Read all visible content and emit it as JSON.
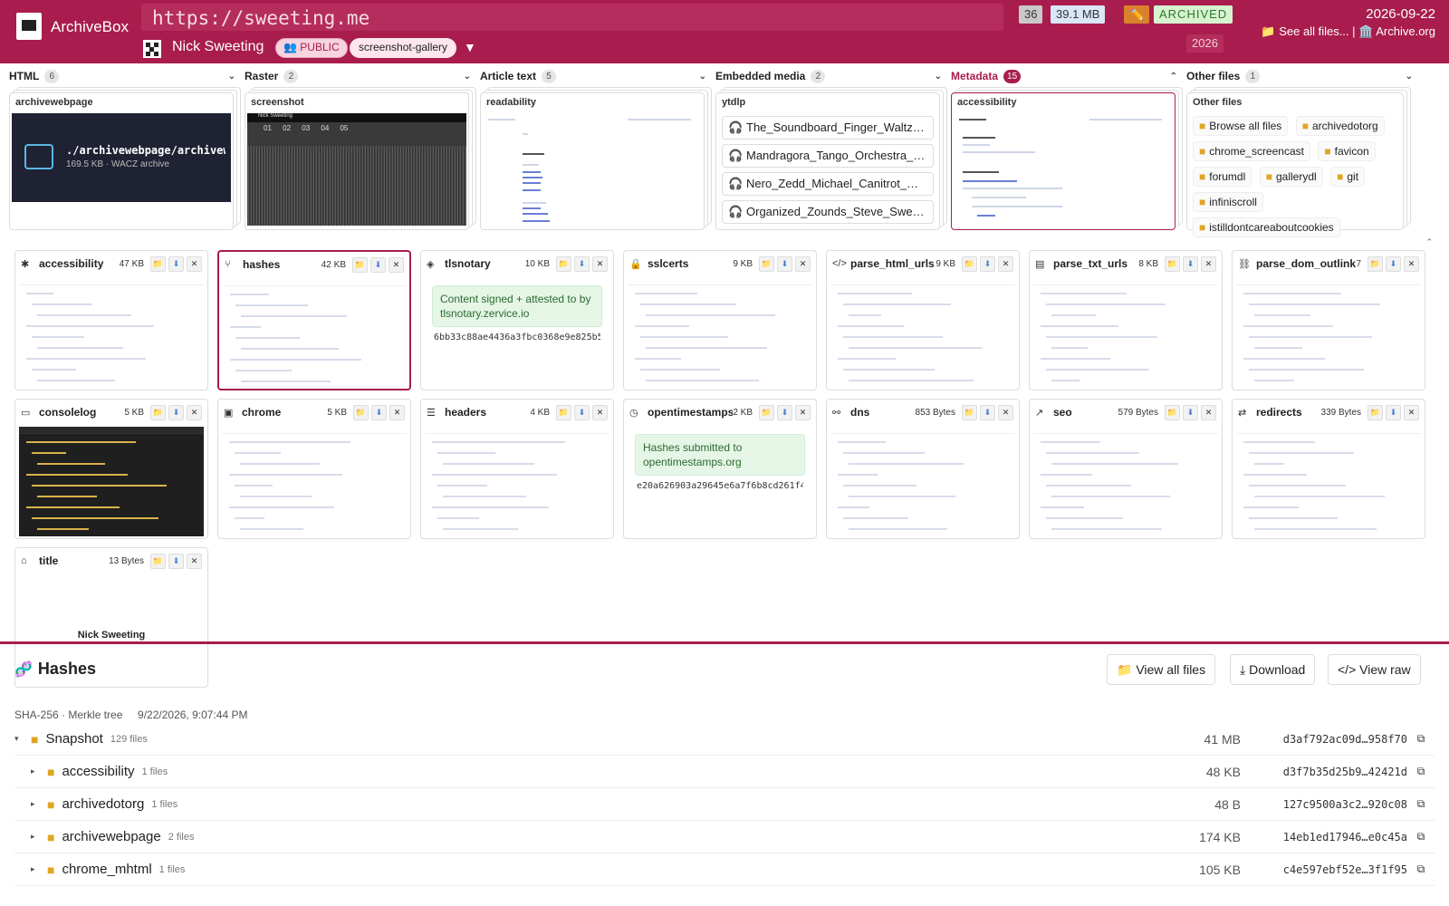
{
  "header": {
    "app_name": "ArchiveBox",
    "url": "https://sweeting.me",
    "owner": "Nick Sweeting",
    "visibility": "👥 PUBLIC",
    "tag": "screenshot-gallery",
    "stat_count": "36",
    "stat_size": "39.1 MB",
    "stat_edit_icon": "✏️",
    "status": "ARCHIVED",
    "year": "2026",
    "date": "2026-09-22",
    "link_files": "📁 See all files...",
    "link_sep": " | ",
    "link_archive": "🏛️ Archive.org",
    "accent_color": "#a91d4e"
  },
  "categories": [
    {
      "label": "HTML",
      "count": "6",
      "card_title": "archivewebpage",
      "file_name": "./archivewebpage/archivew…",
      "file_meta": "169.5 KB · WACZ archive"
    },
    {
      "label": "Raster",
      "count": "2",
      "card_title": "screenshot",
      "nums": "01 02 03 04 05",
      "caption": "Nick Sweeting"
    },
    {
      "label": "Article text",
      "count": "5",
      "card_title": "readability"
    },
    {
      "label": "Embedded media",
      "count": "2",
      "card_title": "ytdlp",
      "items": [
        "The_Soundboard_Finger_Waltz…",
        "Mandragora_Tango_Orchestra_…",
        "Nero_Zedd_Michael_Canitrot_…",
        "Organized_Zounds_Steve_Swe…"
      ]
    },
    {
      "label": "Metadata",
      "count": "15",
      "card_title": "accessibility"
    },
    {
      "label": "Other files",
      "count": "1",
      "card_title": "Other files",
      "items": [
        "Browse all files",
        "archivedotorg",
        "chrome_screencast",
        "favicon",
        "forumdl",
        "gallerydl",
        "git",
        "infiniscroll",
        "istilldontcareaboutcookies"
      ]
    }
  ],
  "cards": [
    {
      "name": "accessibility",
      "icon": "accessibility-icon",
      "glyph": "✱",
      "size": "47 KB"
    },
    {
      "name": "hashes",
      "icon": "hashes-icon",
      "glyph": "⑂",
      "size": "42 KB"
    },
    {
      "name": "tlsnotary",
      "icon": "shield-check-icon",
      "glyph": "◈",
      "size": "10 KB",
      "notice": "Content signed + attested to by tlsnotary.zervice.io",
      "hash": "6bb33c88ae4436a3fbc0368e9e825b5…"
    },
    {
      "name": "sslcerts",
      "icon": "lock-icon",
      "glyph": "🔒",
      "size": "9 KB"
    },
    {
      "name": "parse_html_urls",
      "icon": "code-icon",
      "glyph": "</>",
      "size": "9 KB"
    },
    {
      "name": "parse_txt_urls",
      "icon": "file-text-icon",
      "glyph": "▤",
      "size": "8 KB"
    },
    {
      "name": "parse_dom_outlinks",
      "icon": "link-icon",
      "glyph": "⛓",
      "size": "7"
    },
    {
      "name": "consolelog",
      "icon": "terminal-icon",
      "glyph": "▭",
      "size": "5 KB"
    },
    {
      "name": "chrome",
      "icon": "browser-icon",
      "glyph": "▣",
      "size": "5 KB"
    },
    {
      "name": "headers",
      "icon": "list-icon",
      "glyph": "☰",
      "size": "4 KB"
    },
    {
      "name": "opentimestamps",
      "icon": "clock-icon",
      "glyph": "◷",
      "size": "2 KB",
      "notice": "Hashes submitted to opentimestamps.org",
      "hash": "e20a626903a29645e6a7f6b8cd261f4…"
    },
    {
      "name": "dns",
      "icon": "network-icon",
      "glyph": "⚯",
      "size": "853 Bytes"
    },
    {
      "name": "seo",
      "icon": "trend-icon",
      "glyph": "↗",
      "size": "579 Bytes"
    },
    {
      "name": "redirects",
      "icon": "redirect-icon",
      "glyph": "⇄",
      "size": "339 Bytes"
    },
    {
      "name": "title",
      "icon": "tag-icon",
      "glyph": "⌂",
      "size": "13 Bytes",
      "preview": "Nick Sweeting"
    }
  ],
  "card_buttons": {
    "folder": "📁",
    "download": "⬇",
    "close": "✕"
  },
  "panel": {
    "title": "Hashes",
    "icon": "🧬",
    "view_all": "📁 View all files",
    "download": "⤓ Download",
    "view_raw": "</> View raw",
    "meta": "SHA-256 · Merkle tree     9/22/2026, 9:07:44 PM"
  },
  "tree": [
    {
      "name": "Snapshot",
      "count": "129 files",
      "size": "41 MB",
      "hash": "d3af792ac09d…958f70",
      "level": 0,
      "open": "▾"
    },
    {
      "name": "accessibility",
      "count": "1 files",
      "size": "48 KB",
      "hash": "d3f7b35d25b9…42421d",
      "level": 1,
      "open": "▸"
    },
    {
      "name": "archivedotorg",
      "count": "1 files",
      "size": "48 B",
      "hash": "127c9500a3c2…920c08",
      "level": 1,
      "open": "▸"
    },
    {
      "name": "archivewebpage",
      "count": "2 files",
      "size": "174 KB",
      "hash": "14eb1ed17946…e0c45a",
      "level": 1,
      "open": "▸"
    },
    {
      "name": "chrome_mhtml",
      "count": "1 files",
      "size": "105 KB",
      "hash": "c4e597ebf52e…3f1f95",
      "level": 1,
      "open": "▸"
    }
  ],
  "copy_icon": "⧉"
}
